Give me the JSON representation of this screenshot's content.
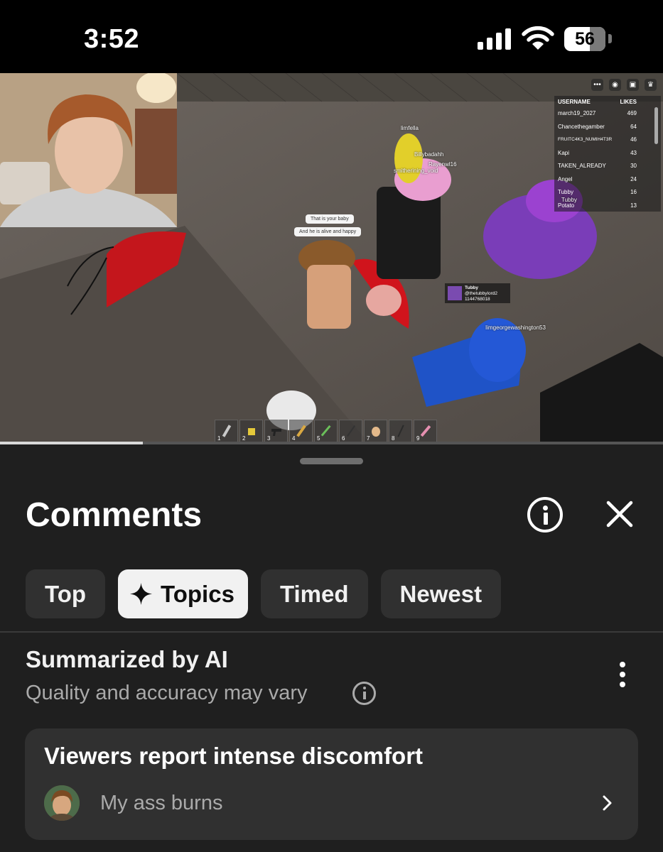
{
  "status_bar": {
    "time": "3:52",
    "battery_level": "56",
    "icons": [
      "cellular-signal-icon",
      "wifi-icon",
      "battery-icon"
    ]
  },
  "video": {
    "progress_fraction": 0.215,
    "game": {
      "leaderboard": {
        "headers": [
          "USERNAME",
          "LIKES"
        ],
        "rows": [
          {
            "name": "march19_2027",
            "likes": "469"
          },
          {
            "name": "Chancethegamber",
            "likes": "64"
          },
          {
            "name": "FRUITC4K3_NUMIH4T3R",
            "likes": "46"
          },
          {
            "name": "Kapi",
            "likes": "43"
          },
          {
            "name": "TAKEN_ALREADY",
            "likes": "30"
          },
          {
            "name": "Angel",
            "likes": "24"
          },
          {
            "name": "Tubby",
            "likes": "16"
          },
          {
            "name": "Potato",
            "likes": "13"
          }
        ]
      },
      "name_tags": {
        "limfella": "limfella",
        "billy": "Billybadahh",
        "raye": "Rayenwl16",
        "smith": "smitherining_void",
        "tubby_overhead": "Tubby",
        "george": "Iimgeorgewashington53"
      },
      "chat": {
        "line1": "That is your baby",
        "line2": "And he is alive and happy"
      },
      "player_card": {
        "name": "Tubby",
        "handle": "@thetubbylord2",
        "id": "1144768018"
      },
      "hotbar_slots": [
        "1",
        "2",
        "3",
        "4",
        "5",
        "6",
        "7",
        "8",
        "9"
      ]
    }
  },
  "comments": {
    "title": "Comments",
    "tabs": [
      {
        "label": "Top",
        "selected": false
      },
      {
        "label": "Topics",
        "selected": true,
        "icon": "sparkle-icon"
      },
      {
        "label": "Timed",
        "selected": false
      },
      {
        "label": "Newest",
        "selected": false
      }
    ],
    "summary": {
      "title": "Summarized by AI",
      "subtitle": "Quality and accuracy may vary"
    },
    "topic": {
      "title": "Viewers report intense discomfort",
      "sample_comment": "My ass burns"
    }
  },
  "colors": {
    "sheet_background": "#1f1f1f",
    "chip_background": "#303030",
    "chip_selected_background": "#f1f1f1",
    "secondary_text": "#aaaaaa"
  }
}
